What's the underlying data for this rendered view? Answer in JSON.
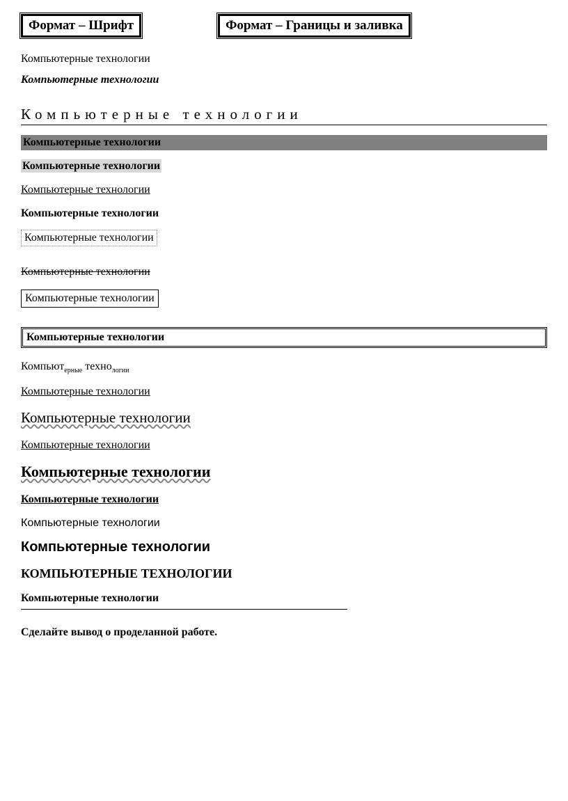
{
  "headers": {
    "left": "Формат – Шрифт",
    "right": "Формат – Границы и заливка"
  },
  "samples": {
    "plain": "Компьютерные технологии",
    "italic": "Компьютерные технологии",
    "spaced": "Компьютерные технологии",
    "gray_full": "Компьютерные технологии",
    "gray_part": "Компьютерные технологии",
    "underline": "Компьютерные технологии",
    "bold": "Компьютерные технологии",
    "dotted": "Компьютерные технологии",
    "strike": "Компьютерные технологии",
    "box1": "Компьютерные технологии",
    "box_double": "Компьютерные технологии",
    "sub_p1": "Компьют",
    "sub_p2": "ерные",
    "sub_p3": " техно",
    "sub_p4": "логии",
    "u2": "Компьютерные технологии",
    "wavy_lg": "Компьютерные технологии",
    "u3": "Компьютерные технологии",
    "wavy_bold": "Компьютерные технологии",
    "ub": "Компьютерные технологии",
    "sans": "Компьютерные технологии",
    "sans_bold": "Компьютерные технологии",
    "caps": "КОМПЬЮТЕРНЫЕ ТЕХНОЛОГИИ",
    "last": "Компьютерные технологии"
  },
  "footer": "Сделайте вывод о проделанной работе."
}
